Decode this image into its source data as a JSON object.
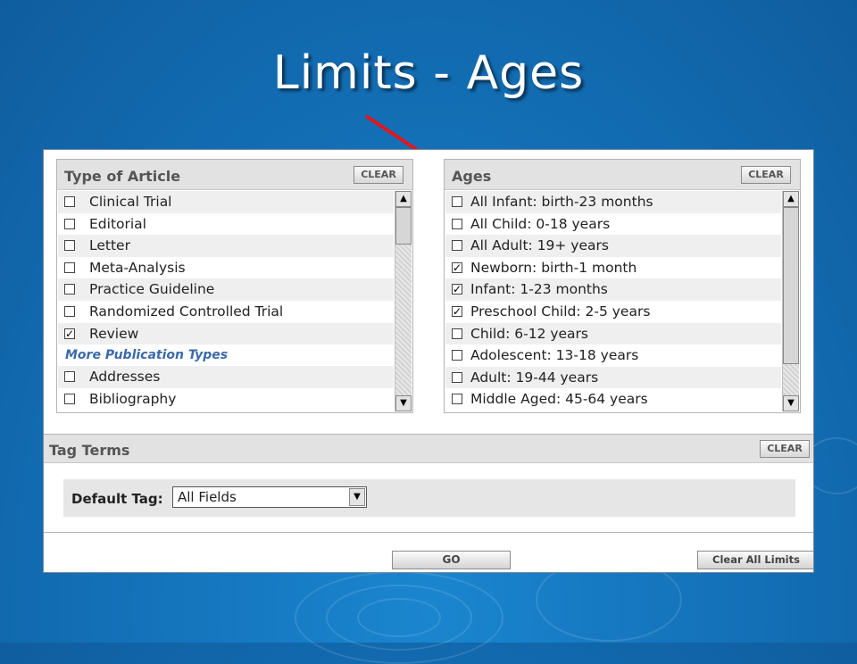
{
  "slide": {
    "title": "Limits - Ages"
  },
  "colors": {
    "arrow": "#e8141a",
    "background": "#1473bb",
    "link": "#3b6aa8"
  },
  "type_of_article": {
    "title": "Type of Article",
    "clear_label": "CLEAR",
    "items": [
      {
        "label": "Clinical Trial",
        "checked": false
      },
      {
        "label": "Editorial",
        "checked": false
      },
      {
        "label": "Letter",
        "checked": false
      },
      {
        "label": "Meta-Analysis",
        "checked": false
      },
      {
        "label": "Practice Guideline",
        "checked": false
      },
      {
        "label": "Randomized Controlled Trial",
        "checked": false
      },
      {
        "label": "Review",
        "checked": true
      }
    ],
    "more_label": "More Publication Types",
    "more_items": [
      {
        "label": "Addresses",
        "checked": false
      },
      {
        "label": "Bibliography",
        "checked": false
      }
    ]
  },
  "ages": {
    "title": "Ages",
    "clear_label": "CLEAR",
    "items": [
      {
        "label": "All Infant: birth-23 months",
        "checked": false
      },
      {
        "label": "All Child: 0-18 years",
        "checked": false
      },
      {
        "label": "All Adult: 19+ years",
        "checked": false
      },
      {
        "label": "Newborn: birth-1 month",
        "checked": true
      },
      {
        "label": "Infant: 1-23 months",
        "checked": true
      },
      {
        "label": "Preschool Child: 2-5 years",
        "checked": true
      },
      {
        "label": "Child: 6-12 years",
        "checked": false
      },
      {
        "label": "Adolescent: 13-18 years",
        "checked": false
      },
      {
        "label": "Adult: 19-44 years",
        "checked": false
      },
      {
        "label": "Middle Aged: 45-64 years",
        "checked": false
      }
    ]
  },
  "tag_terms": {
    "title": "Tag Terms",
    "clear_label": "CLEAR",
    "default_tag_label": "Default Tag:",
    "selected": "All Fields"
  },
  "footer": {
    "go_label": "GO",
    "clear_all_label": "Clear All Limits"
  }
}
